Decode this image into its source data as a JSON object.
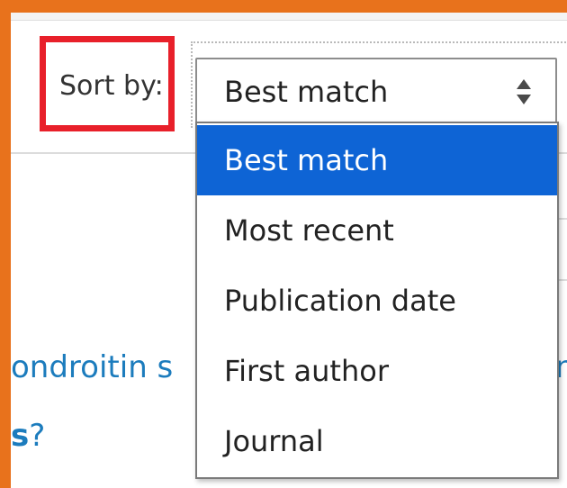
{
  "sort": {
    "label": "Sort by:",
    "selected_value": "Best match",
    "options": [
      {
        "label": "Best match",
        "selected": true
      },
      {
        "label": "Most recent",
        "selected": false
      },
      {
        "label": "Publication date",
        "selected": false
      },
      {
        "label": "First author",
        "selected": false
      },
      {
        "label": "Journal",
        "selected": false
      }
    ]
  },
  "result": {
    "title_left_fragment": "ondroitin s",
    "title_right_fragment": "n",
    "line2_bold_fragment": "s",
    "line2_suffix": "?"
  },
  "colors": {
    "highlight_box": "#e8202a",
    "selected_option": "#0e64d5",
    "result_link": "#1c7cbd",
    "frame_background": "#e8721c"
  },
  "icons": {
    "select_arrows": "up-down-arrows-icon"
  }
}
